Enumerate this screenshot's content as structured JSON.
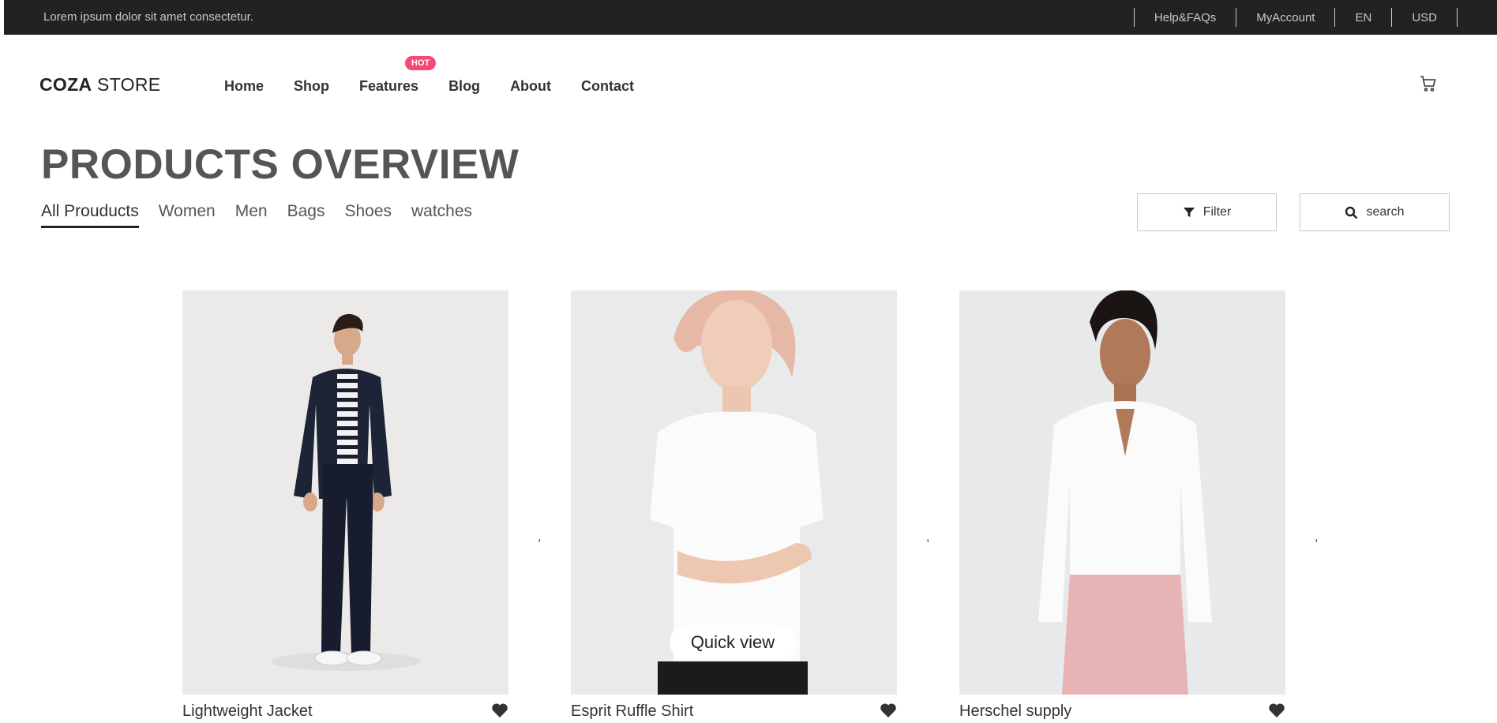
{
  "topbar": {
    "promo": "Lorem ipsum dolor sit amet consectetur.",
    "links": [
      "Help&FAQs",
      "MyAccount",
      "EN",
      "USD"
    ]
  },
  "header": {
    "logo_bold": "COZA",
    "logo_rest": " STORE",
    "nav": [
      "Home",
      "Shop",
      "Features",
      "Blog",
      "About",
      "Contact"
    ],
    "hot_badge": "HOT",
    "cart_icon": "cart-icon"
  },
  "page_title": "PRODUCTS OVERVIEW",
  "categories": [
    "All Prouducts",
    "Women",
    "Men",
    "Bags",
    "Shoes",
    "watches"
  ],
  "active_category": "All Prouducts",
  "buttons": {
    "filter": "Filter",
    "search": "search"
  },
  "products": [
    {
      "name": "Lightweight Jacket"
    },
    {
      "name": "Esprit Ruffle Shirt",
      "quick_view": "Quick view"
    },
    {
      "name": "Herschel supply"
    }
  ],
  "separators": [
    ",",
    ",",
    ","
  ],
  "colors": {
    "topbar": "#222222",
    "hot": "#f74877",
    "text": "#333333"
  }
}
